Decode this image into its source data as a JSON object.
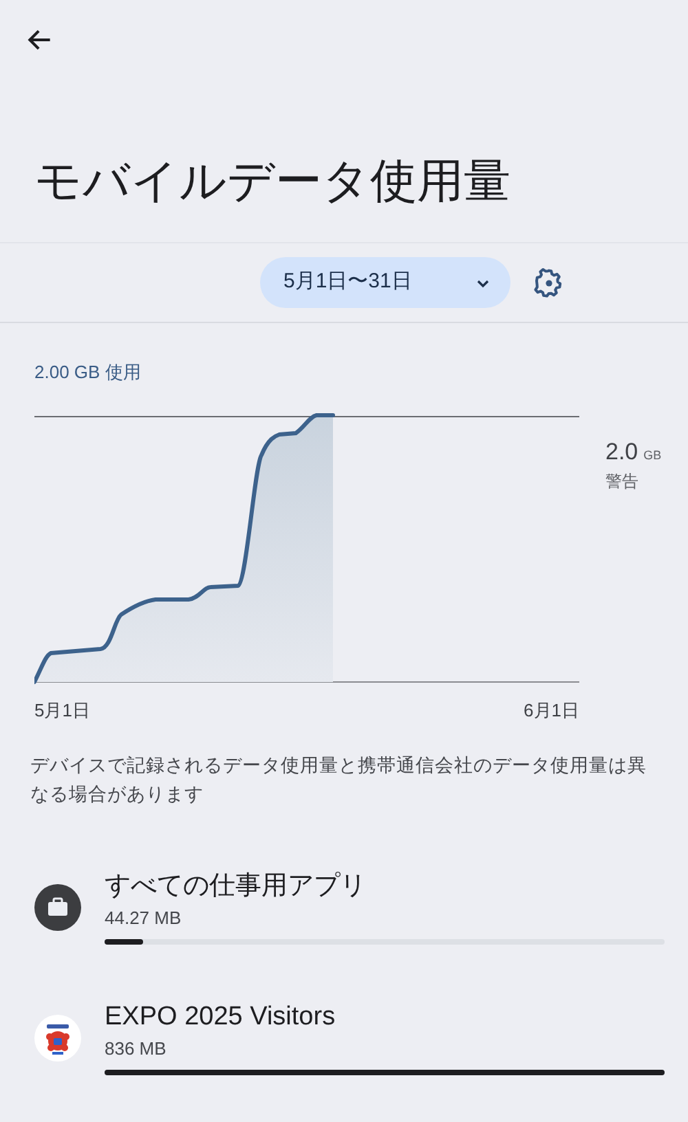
{
  "title": "モバイルデータ使用量",
  "cycle": {
    "label": "5月1日〜31日"
  },
  "usage": "2.00 GB 使用",
  "chart": {
    "warning_value": "2.0",
    "warning_unit": "GB",
    "warning_label": "警告",
    "x_start": "5月1日",
    "x_end": "6月1日"
  },
  "note": "デバイスで記録されるデータ使用量と携帯通信会社のデータ使用量は異なる場合があります",
  "apps": [
    {
      "kind": "work",
      "name": "すべての仕事用アプリ",
      "size": "44.27 MB",
      "level": 0.07
    },
    {
      "kind": "app",
      "name": "EXPO 2025 Visitors",
      "size": "836 MB",
      "level": 1.0
    }
  ]
}
